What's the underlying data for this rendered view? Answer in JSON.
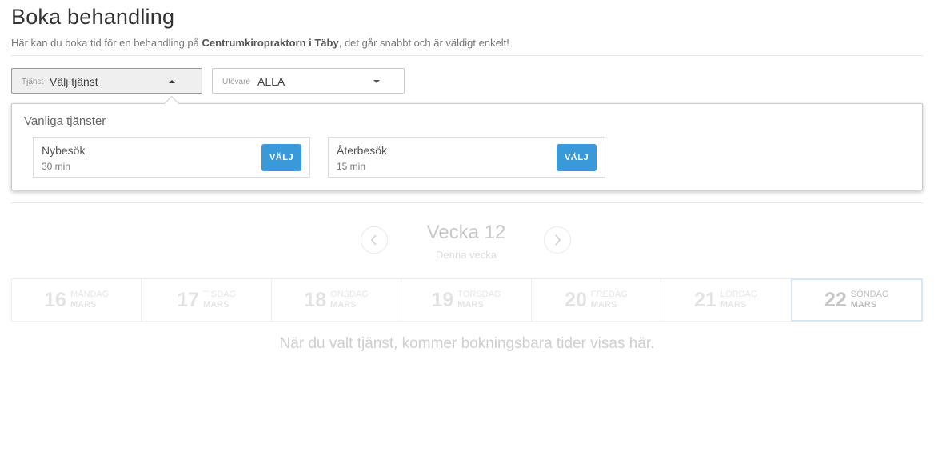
{
  "header": {
    "title": "Boka behandling",
    "subtitle_before": "Här kan du boka tid för en behandling på ",
    "subtitle_clinic": "Centrumkiropraktorn i Täby",
    "subtitle_after": ", det går snabbt och är väldigt enkelt!"
  },
  "filters": {
    "service": {
      "label": "Tjänst",
      "value": "Välj tjänst",
      "icon": "caret-up-icon"
    },
    "practitioner": {
      "label": "Utövare",
      "value": "ALLA",
      "icon": "caret-down-icon"
    }
  },
  "dropdown": {
    "heading": "Vanliga tjänster",
    "services": [
      {
        "name": "Nybesök",
        "duration": "30 min",
        "button": "VÄLJ"
      },
      {
        "name": "Återbesök",
        "duration": "15 min",
        "button": "VÄLJ"
      }
    ],
    "button_color": "#3a9ad9"
  },
  "week": {
    "title": "Vecka 12",
    "subtitle": "Denna vecka",
    "prev_icon": "chevron-left-icon",
    "next_icon": "chevron-right-icon"
  },
  "days": [
    {
      "num": "16",
      "name": "MÅNDAG",
      "month": "MARS",
      "selected": false
    },
    {
      "num": "17",
      "name": "TISDAG",
      "month": "MARS",
      "selected": false
    },
    {
      "num": "18",
      "name": "ONSDAG",
      "month": "MARS",
      "selected": false
    },
    {
      "num": "19",
      "name": "TORSDAG",
      "month": "MARS",
      "selected": false
    },
    {
      "num": "20",
      "name": "FREDAG",
      "month": "MARS",
      "selected": false
    },
    {
      "num": "21",
      "name": "LÖRDAG",
      "month": "MARS",
      "selected": false
    },
    {
      "num": "22",
      "name": "SÖNDAG",
      "month": "MARS",
      "selected": true
    }
  ],
  "empty_message": "När du valt tjänst, kommer bokningsbara tider visas här."
}
